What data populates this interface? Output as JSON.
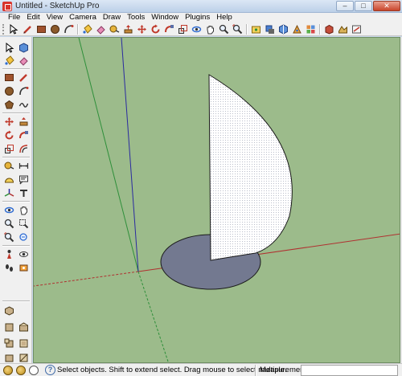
{
  "window": {
    "title": "Untitled - SketchUp Pro",
    "minimize": "–",
    "maximize": "□",
    "close": "✕"
  },
  "menu": [
    "File",
    "Edit",
    "View",
    "Camera",
    "Draw",
    "Tools",
    "Window",
    "Plugins",
    "Help"
  ],
  "toolbar_icons": [
    "select",
    "pencil",
    "rectangle",
    "circle",
    "arc",
    "paint-bucket",
    "eraser",
    "tape-measure",
    "push-pull",
    "move",
    "rotate",
    "follow-me",
    "scale",
    "orbit",
    "pan",
    "zoom",
    "zoom-extents",
    "previous-view",
    "add-location",
    "shadows",
    "get-models",
    "share-model",
    "component",
    "extension"
  ],
  "left_toolbar_icons": [
    "select",
    "component",
    "paint-bucket",
    "eraser",
    "rectangle",
    "line",
    "circle",
    "arc",
    "polygon",
    "freehand",
    "move",
    "push-pull",
    "rotate",
    "follow-me",
    "scale",
    "offset",
    "tape-measure",
    "dimension",
    "protractor",
    "text",
    "axes",
    "3d-text",
    "orbit",
    "pan",
    "zoom",
    "zoom-window",
    "zoom-extents",
    "previous",
    "position-camera",
    "look-around",
    "walk",
    "section-plane",
    "iso-view",
    "top-view",
    "front-view",
    "right-view",
    "back-view",
    "left-view",
    "walk-feet",
    "footprints"
  ],
  "status": {
    "message": "Select objects. Shift to extend select. Drag mouse to select multiple.",
    "help_symbol": "?",
    "measurements_label": "Measurements",
    "measurements_value": ""
  },
  "colors": {
    "viewport_bg": "#9cbb8b",
    "axis_red": "#b03030",
    "axis_green": "#2e8f3a",
    "axis_blue": "#2a2aa0",
    "disc_fill": "#737990",
    "semicircle_fill": "#ffffff"
  }
}
